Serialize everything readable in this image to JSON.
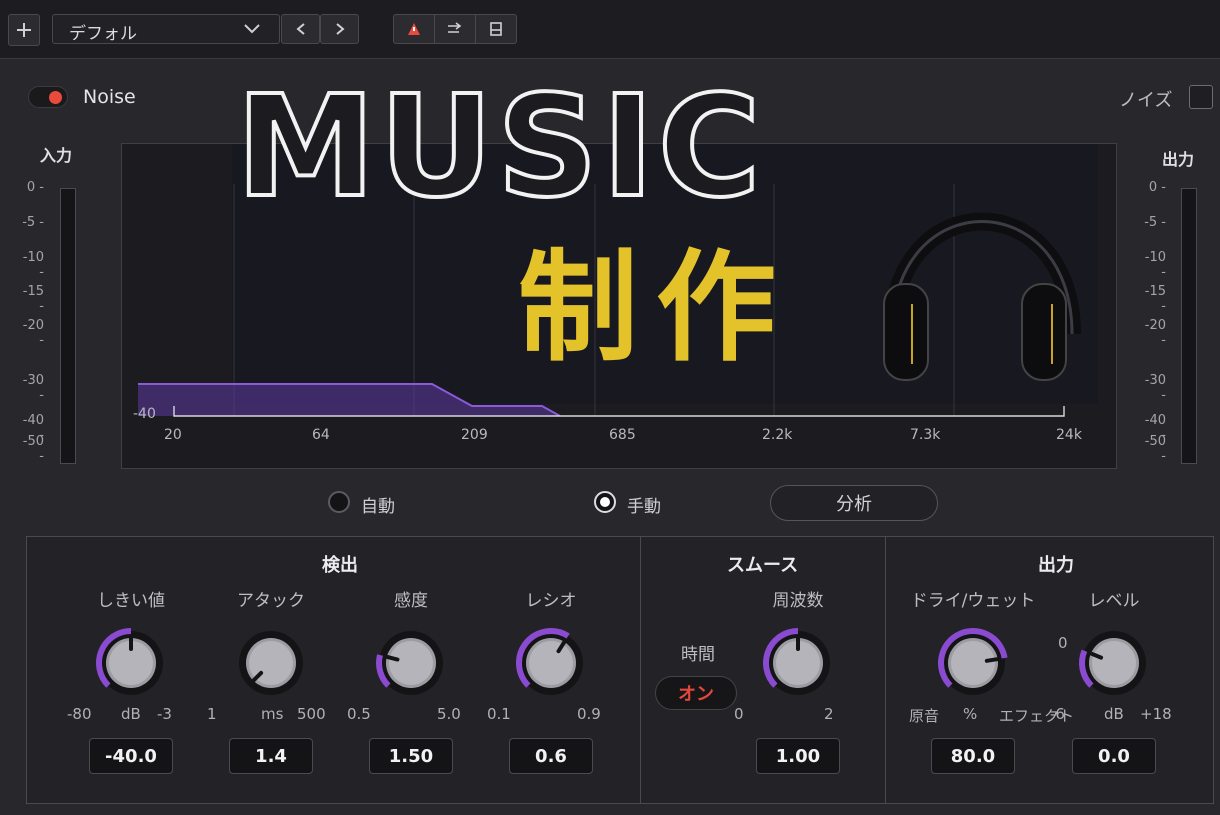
{
  "toolbar": {
    "preset_value": "デフォル"
  },
  "noise": {
    "label": "Noise",
    "enabled": true,
    "jp_label": "ノイズ"
  },
  "meters": {
    "input_title": "入力",
    "output_title": "出力",
    "scale": [
      "0",
      "-5",
      "-10",
      "-15",
      "-20",
      "-30",
      "-40",
      "-50"
    ]
  },
  "graph": {
    "y_bottom_label": "-40",
    "x_labels": [
      "20",
      "64",
      "209",
      "685",
      "2.2k",
      "7.3k",
      "24k"
    ],
    "overlay_title": "MUSIC",
    "overlay_subtitle": "制作"
  },
  "mode": {
    "auto_label": "自動",
    "manual_label": "手動",
    "selected": "manual",
    "analyze_label": "分析"
  },
  "detection": {
    "title": "検出",
    "knobs": [
      {
        "label": "しきい値",
        "min": "-80",
        "unit": "dB",
        "max": "-3",
        "value": "-40.0",
        "fraction": 0.5
      },
      {
        "label": "アタック",
        "min": "1",
        "unit": "ms",
        "max": "500",
        "value": "1.4",
        "fraction": 0.0
      },
      {
        "label": "感度",
        "min": "0.5",
        "unit": "",
        "max": "5.0",
        "value": "1.50",
        "fraction": 0.22
      },
      {
        "label": "レシオ",
        "min": "0.1",
        "unit": "",
        "max": "0.9",
        "value": "0.6",
        "fraction": 0.62
      }
    ]
  },
  "smooth": {
    "title": "スムース",
    "time_label": "時間",
    "time_toggle": "オン",
    "knob": {
      "label": "周波数",
      "min": "0",
      "max": "2",
      "value": "1.00",
      "fraction": 0.5
    }
  },
  "output": {
    "title": "出力",
    "knobs": [
      {
        "label": "ドライ/ウェット",
        "min": "原音",
        "mid": "%",
        "max": "エフェクト",
        "value": "80.0",
        "fraction": 0.8
      },
      {
        "label": "レベル",
        "zero": "0",
        "min": "-6",
        "unit": "dB",
        "max": "+18",
        "value": "0.0",
        "fraction": 0.25
      }
    ]
  },
  "colors": {
    "accent": "#8a4bd0",
    "toggle_on": "#e84a3c",
    "overlay_yellow": "#e3c22a",
    "curve": "#7a4ac8"
  }
}
